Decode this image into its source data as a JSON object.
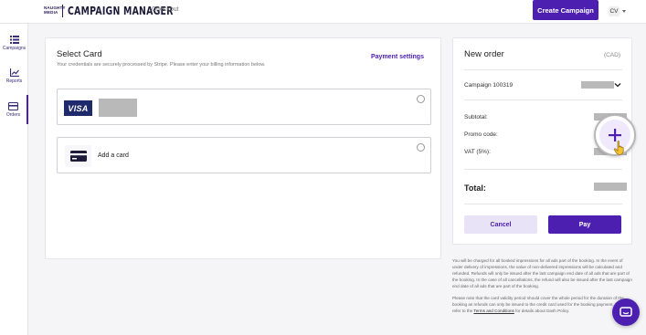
{
  "header": {
    "brand_small": [
      "NAUGHTY",
      "MEDIA"
    ],
    "brand_main": "CAMPAIGN MANAGER",
    "breadcrumb": "Checkout",
    "create_button": "Create Campaign",
    "user_initials": "CV"
  },
  "sidebar": {
    "items": [
      {
        "label": "Campaigns",
        "icon": "list-icon"
      },
      {
        "label": "Reports",
        "icon": "chart-icon"
      },
      {
        "label": "Orders",
        "icon": "orders-icon",
        "active": true
      }
    ]
  },
  "select_card": {
    "title": "Select Card",
    "subtitle": "Your credentials are securely processed by Stripe. Please enter your billing information below.",
    "payment_settings": "Payment settings",
    "visa_text": "VISA",
    "add_card": "Add a card"
  },
  "order": {
    "title": "New order",
    "currency": "(CAD)",
    "campaign": "Campaign 100319",
    "subtotal_label": "Subtotal:",
    "promo_label": "Promo code:",
    "vat_label": "VAT (5%):",
    "total_label": "Total:",
    "cancel_button": "Cancel",
    "pay_button": "Pay"
  },
  "disclaimer": {
    "paragraph1": "You will be charged for all booked impressions for all ads part of the booking. In the event of under delivery of impressions, the value of non-delivered impressions will be calculated and refunded. Refunds will only be issued after the last campaign end date of all ads that are part of the booking. In the case of all cancellations, the refund will also be issued after the last campaign end date of all ads that are part of the booking.",
    "paragraph2_before": "Please note that the card validity period should cover the whole period for the duration of the booking as refunds can only be issued to the credit card used for the booking payment. Please refer to the ",
    "paragraph2_link": "Terms and Conditions",
    "paragraph2_after": " for details about Dash Policy."
  },
  "colors": {
    "accent": "#4c1fb0",
    "accent_light": "#e9e3f8",
    "masked": "#b9b9b9"
  }
}
